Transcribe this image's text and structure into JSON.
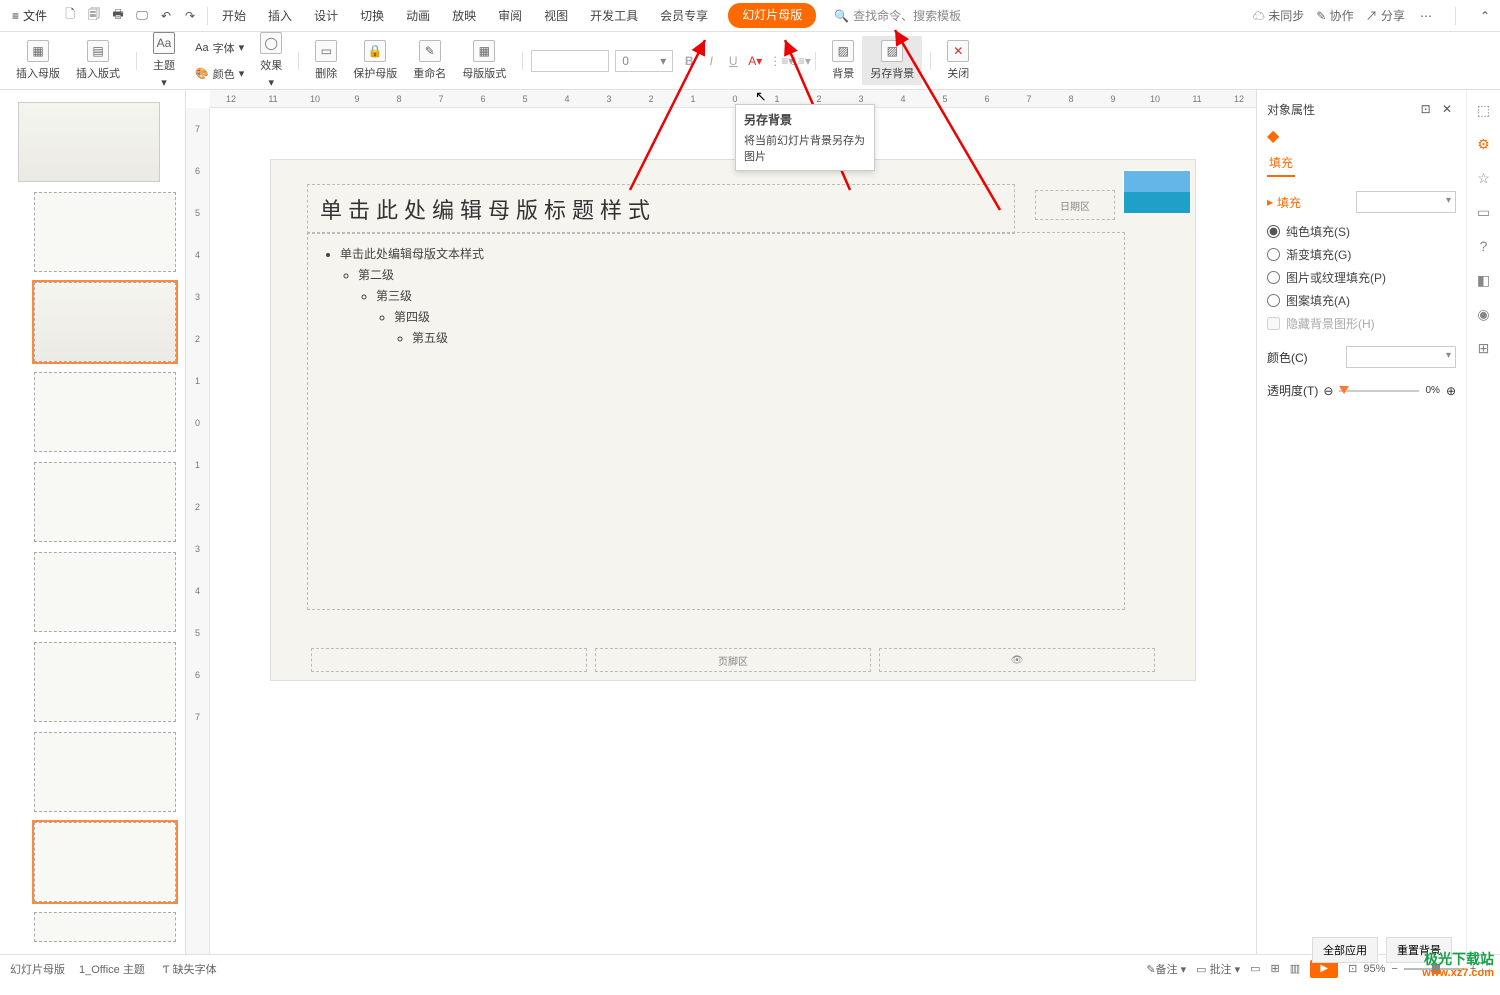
{
  "menubar": {
    "file": "文件",
    "tabs": [
      "开始",
      "插入",
      "设计",
      "切换",
      "动画",
      "放映",
      "审阅",
      "视图",
      "开发工具",
      "会员专享"
    ],
    "active_tab": "幻灯片母版",
    "search_placeholder": "查找命令、搜索模板",
    "unsync": "未同步",
    "collab": "协作",
    "share": "分享"
  },
  "ribbon": {
    "insert_master": "插入母版",
    "insert_layout": "插入版式",
    "theme": "主题",
    "font": "字体",
    "color": "颜色",
    "effect": "效果",
    "delete": "删除",
    "protect": "保护母版",
    "rename": "重命名",
    "master_layout": "母版版式",
    "size_value": "0",
    "bg": "背景",
    "save_bg": "另存背景",
    "close": "关闭",
    "aa": "Aa"
  },
  "tooltip": {
    "title": "另存背景",
    "body": "将当前幻灯片背景另存为图片"
  },
  "slide": {
    "title": "单击此处编辑母版标题样式",
    "date": "日期区",
    "bullet1": "单击此处编辑母版文本样式",
    "lvl2": "第二级",
    "lvl3": "第三级",
    "lvl4": "第四级",
    "lvl5": "第五级",
    "footer": "页脚区"
  },
  "ruler_h": [
    "12",
    "11",
    "10",
    "9",
    "8",
    "7",
    "6",
    "5",
    "4",
    "3",
    "2",
    "1",
    "0",
    "1",
    "2",
    "3",
    "4",
    "5",
    "6",
    "7",
    "8",
    "9",
    "10",
    "11",
    "12"
  ],
  "ruler_v": [
    "7",
    "6",
    "5",
    "4",
    "3",
    "2",
    "1",
    "0",
    "1",
    "2",
    "3",
    "4",
    "5",
    "6",
    "7"
  ],
  "panel": {
    "title": "对象属性",
    "tab": "填充",
    "section": "填充",
    "solid": "纯色填充(S)",
    "gradient": "渐变填充(G)",
    "texture": "图片或纹理填充(P)",
    "pattern": "图案填充(A)",
    "hidebg": "隐藏背景图形(H)",
    "color_label": "颜色(C)",
    "opacity_label": "透明度(T)",
    "opacity_val": "0%",
    "apply_all": "全部应用",
    "reset_bg": "重置背景"
  },
  "statusbar": {
    "master": "幻灯片母版",
    "theme": "1_Office 主题",
    "missing_font": "缺失字体",
    "notes": "备注",
    "comments": "批注",
    "zoom": "95%"
  },
  "watermark": {
    "name": "极光下载站",
    "url": "www.xz7.com"
  }
}
